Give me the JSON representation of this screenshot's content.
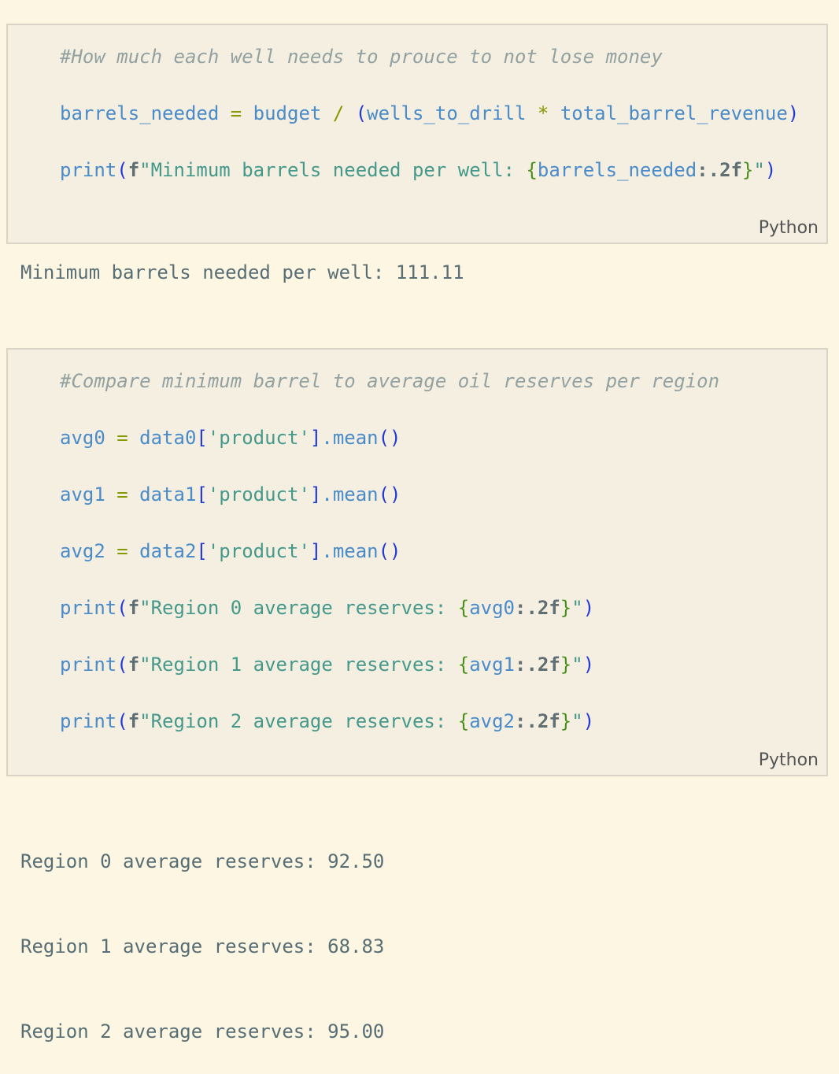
{
  "cells": [
    {
      "language": "Python",
      "comment": "#How much each well needs to prouce to not lose money",
      "code": {
        "var": "barrels_needed",
        "eq": "=",
        "budget": "budget",
        "div": "/",
        "lparen": "(",
        "wells": "wells_to_drill",
        "mul": "*",
        "revenue": "total_barrel_revenue",
        "rparen": ")",
        "print": {
          "fn": "print",
          "open": "(",
          "prefix": "f",
          "quote_open": "\"",
          "text": "Minimum barrels needed per well: ",
          "brace_open": "{",
          "expr": "barrels_needed",
          "fmt": ":.2f",
          "brace_close": "}",
          "quote_close": "\"",
          "close": ")"
        }
      },
      "output": [
        "Minimum barrels needed per well: 111.11"
      ]
    },
    {
      "language": "Python",
      "comment": "#Compare minimum barrel to average oil reserves per region",
      "assignments": [
        {
          "var": "avg0",
          "eq": "=",
          "obj": "data0",
          "ob": "[",
          "key": "'product'",
          "cb": "]",
          "dot": ".",
          "method": "mean",
          "call": "()"
        },
        {
          "var": "avg1",
          "eq": "=",
          "obj": "data1",
          "ob": "[",
          "key": "'product'",
          "cb": "]",
          "dot": ".",
          "method": "mean",
          "call": "()"
        },
        {
          "var": "avg2",
          "eq": "=",
          "obj": "data2",
          "ob": "[",
          "key": "'product'",
          "cb": "]",
          "dot": ".",
          "method": "mean",
          "call": "()"
        }
      ],
      "prints": [
        {
          "fn": "print",
          "open": "(",
          "prefix": "f",
          "quote_open": "\"",
          "text": "Region 0 average reserves: ",
          "brace_open": "{",
          "expr": "avg0",
          "fmt": ":.2f",
          "brace_close": "}",
          "quote_close": "\"",
          "close": ")"
        },
        {
          "fn": "print",
          "open": "(",
          "prefix": "f",
          "quote_open": "\"",
          "text": "Region 1 average reserves: ",
          "brace_open": "{",
          "expr": "avg1",
          "fmt": ":.2f",
          "brace_close": "}",
          "quote_close": "\"",
          "close": ")"
        },
        {
          "fn": "print",
          "open": "(",
          "prefix": "f",
          "quote_open": "\"",
          "text": "Region 2 average reserves: ",
          "brace_open": "{",
          "expr": "avg2",
          "fmt": ":.2f",
          "brace_close": "}",
          "quote_close": "\"",
          "close": ")"
        }
      ],
      "output": [
        "Region 0 average reserves: 92.50",
        "Region 1 average reserves: 68.83",
        "Region 2 average reserves: 95.00"
      ]
    }
  ]
}
